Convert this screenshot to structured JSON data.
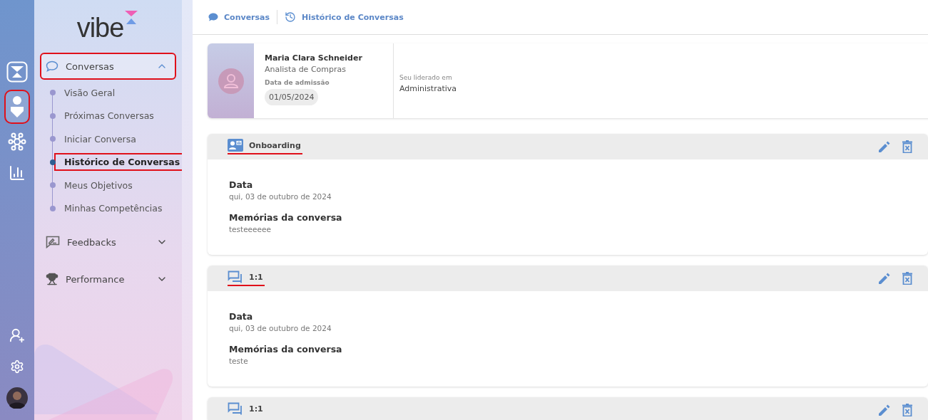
{
  "rail": {
    "items": [
      {
        "kind": "logo",
        "selected": false,
        "highlighted": false
      },
      {
        "kind": "assistant",
        "selected": true,
        "highlighted": true
      },
      {
        "kind": "network",
        "selected": false,
        "highlighted": false
      },
      {
        "kind": "chart",
        "selected": false,
        "highlighted": false
      }
    ],
    "bottom": [
      {
        "kind": "add-user"
      },
      {
        "kind": "settings"
      },
      {
        "kind": "avatar"
      }
    ]
  },
  "sidebar": {
    "logo": "vibe",
    "menu": [
      {
        "label": "Conversas",
        "kind": "chat",
        "expanded": true,
        "highlighted": true,
        "children": [
          {
            "label": "Visão Geral",
            "selected": false,
            "highlighted": false
          },
          {
            "label": "Próximas Conversas",
            "selected": false,
            "highlighted": false
          },
          {
            "label": "Iniciar Conversa",
            "selected": false,
            "highlighted": false
          },
          {
            "label": "Histórico de Conversas",
            "selected": true,
            "highlighted": true
          },
          {
            "label": "Meus Objetivos",
            "selected": false,
            "highlighted": false
          },
          {
            "label": "Minhas Competências",
            "selected": false,
            "highlighted": false
          }
        ]
      },
      {
        "label": "Feedbacks",
        "kind": "feedback",
        "expanded": false,
        "highlighted": false
      },
      {
        "label": "Performance",
        "kind": "trophy",
        "expanded": false,
        "highlighted": false
      }
    ]
  },
  "breadcrumb": [
    {
      "label": "Conversas",
      "kind": "chat"
    },
    {
      "label": "Histórico de Conversas",
      "kind": "history"
    }
  ],
  "profile": {
    "name": "Maria Clara Schneider",
    "role": "Analista de Compras",
    "admission_label": "Data de admissão",
    "admission_date": "01/05/2024",
    "team_label": "Seu liderado em",
    "team": "Administrativa"
  },
  "conversations": [
    {
      "kind": "onboarding",
      "title": "Onboarding",
      "underlined": true,
      "fields": [
        {
          "label": "Data",
          "value": "qui, 03 de outubro de 2024"
        },
        {
          "label": "Memórias da conversa",
          "value": "testeeeeee"
        }
      ]
    },
    {
      "kind": "one-on-one",
      "title": "1:1",
      "underlined": true,
      "fields": [
        {
          "label": "Data",
          "value": "qui, 03 de outubro de 2024"
        },
        {
          "label": "Memórias da conversa",
          "value": "teste"
        }
      ]
    },
    {
      "kind": "one-on-one",
      "title": "1:1",
      "underlined": false
    }
  ]
}
